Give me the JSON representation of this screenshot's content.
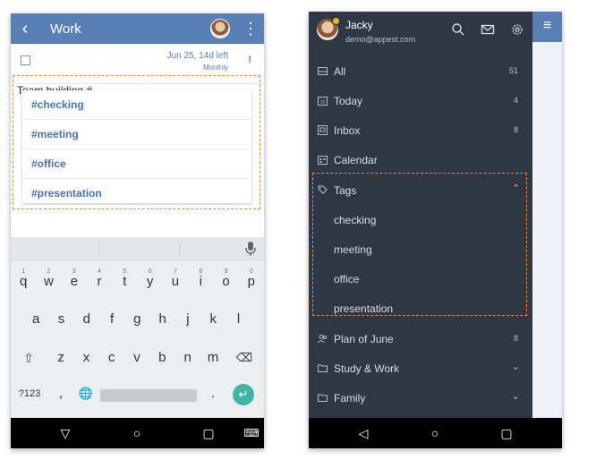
{
  "left": {
    "appbar": {
      "title": "Work"
    },
    "task": {
      "due": "Jun 25, 14d left",
      "repeat": "Monthly",
      "priority": "!"
    },
    "input_text": "Team building #",
    "suggestions": [
      "#checking",
      "#meeting",
      "#office",
      "#presentation"
    ],
    "keyboard": {
      "row1": [
        {
          "k": "q",
          "h": "1"
        },
        {
          "k": "w",
          "h": "2"
        },
        {
          "k": "e",
          "h": "3"
        },
        {
          "k": "r",
          "h": "4"
        },
        {
          "k": "t",
          "h": "5"
        },
        {
          "k": "y",
          "h": "6"
        },
        {
          "k": "u",
          "h": "7"
        },
        {
          "k": "i",
          "h": "8"
        },
        {
          "k": "o",
          "h": "9"
        },
        {
          "k": "p",
          "h": "0"
        }
      ],
      "row2": [
        "a",
        "s",
        "d",
        "f",
        "g",
        "h",
        "j",
        "k",
        "l"
      ],
      "row3": [
        "z",
        "x",
        "c",
        "v",
        "b",
        "n",
        "m"
      ],
      "symbols": "?123",
      "comma": ",",
      "period": "."
    },
    "navbar": {}
  },
  "right": {
    "profile": {
      "name": "Jacky",
      "email": "demo@appest.com"
    },
    "menu": [
      {
        "label": "All",
        "count": "51",
        "icon": "inbox-tray-icon"
      },
      {
        "label": "Today",
        "count": "4",
        "icon": "calendar-day-icon"
      },
      {
        "label": "Inbox",
        "count": "8",
        "icon": "inbox-icon"
      },
      {
        "label": "Calendar",
        "count": "",
        "icon": "calendar-grid-icon"
      },
      {
        "label": "Tags",
        "count": "",
        "icon": "tag-icon"
      },
      {
        "label": "checking",
        "count": "",
        "icon": ""
      },
      {
        "label": "meeting",
        "count": "",
        "icon": ""
      },
      {
        "label": "office",
        "count": "",
        "icon": ""
      },
      {
        "label": "presentation",
        "count": "",
        "icon": ""
      },
      {
        "label": "Plan of June",
        "count": "8",
        "icon": "shared-list-icon"
      },
      {
        "label": "Study & Work",
        "count": "",
        "icon": "folder-icon"
      },
      {
        "label": "Family",
        "count": "",
        "icon": "folder-icon"
      }
    ]
  },
  "colors": {
    "appbar": "#5a7fb4",
    "drawer": "#303744",
    "highlight_dash": "#e98a3a",
    "accent_teal": "#40b5a6"
  }
}
